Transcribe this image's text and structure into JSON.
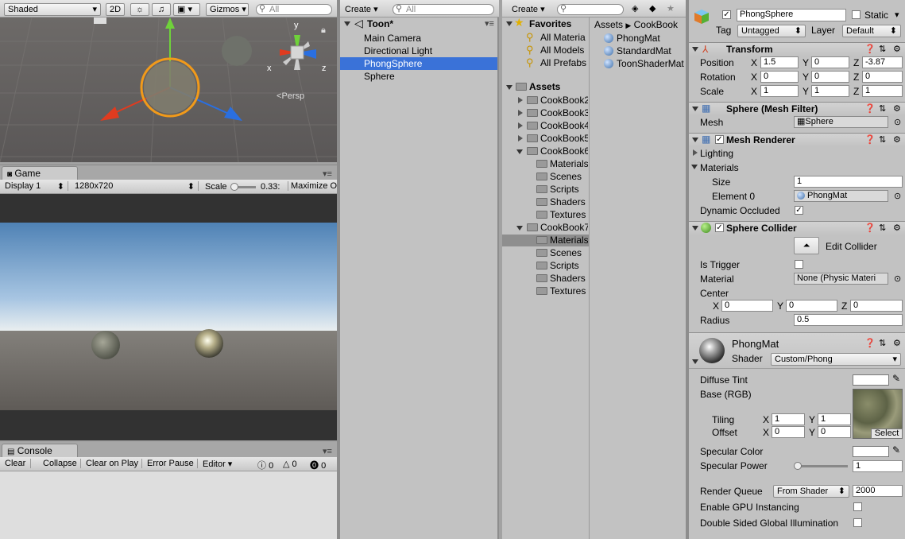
{
  "scene": {
    "shading_mode": "Shaded",
    "mode_2d": "2D",
    "gizmos_label": "Gizmos",
    "search_placeholder": "All",
    "persp_label": "Persp",
    "axes": {
      "y": "y",
      "x": "x",
      "z": "z"
    }
  },
  "game": {
    "tab_label": "Game",
    "display": "Display 1",
    "resolution": "1280x720",
    "scale_label": "Scale",
    "scale_value": "0.33:",
    "maximize_label": "Maximize O"
  },
  "console": {
    "tab_label": "Console",
    "buttons": [
      "Clear",
      "Collapse",
      "Clear on Play",
      "Error Pause",
      "Editor"
    ],
    "counts": {
      "info": "0",
      "warn": "0",
      "error": "0"
    }
  },
  "hierarchy": {
    "create_label": "Create",
    "search_placeholder": "All",
    "scene_name": "Toon*",
    "items": [
      "Main Camera",
      "Directional Light",
      "PhongSphere",
      "Sphere"
    ],
    "selected_index": 2
  },
  "project": {
    "create_label": "Create",
    "favorites_label": "Favorites",
    "favorites": [
      "All Materia",
      "All Models",
      "All Prefabs"
    ],
    "assets_label": "Assets",
    "folders": [
      {
        "name": "CookBook2",
        "level": 1,
        "expanded": false
      },
      {
        "name": "CookBook3",
        "level": 1,
        "expanded": false
      },
      {
        "name": "CookBook4",
        "level": 1,
        "expanded": false
      },
      {
        "name": "CookBook5",
        "level": 1,
        "expanded": false
      },
      {
        "name": "CookBook6",
        "level": 1,
        "expanded": true
      },
      {
        "name": "Materials",
        "level": 2
      },
      {
        "name": "Scenes",
        "level": 2
      },
      {
        "name": "Scripts",
        "level": 2
      },
      {
        "name": "Shaders",
        "level": 2
      },
      {
        "name": "Textures",
        "level": 2
      },
      {
        "name": "CookBook7",
        "level": 1,
        "expanded": true
      },
      {
        "name": "Materials",
        "level": 2,
        "selected": true
      },
      {
        "name": "Scenes",
        "level": 2
      },
      {
        "name": "Scripts",
        "level": 2
      },
      {
        "name": "Shaders",
        "level": 2
      },
      {
        "name": "Textures",
        "level": 2
      }
    ],
    "breadcrumb": [
      "Assets",
      "CookBook"
    ],
    "assets": [
      "PhongMat",
      "StandardMat",
      "ToonShaderMat"
    ]
  },
  "inspector": {
    "object_name": "PhongSphere",
    "static_label": "Static",
    "tag_label": "Tag",
    "tag_value": "Untagged",
    "layer_label": "Layer",
    "layer_value": "Default",
    "transform": {
      "title": "Transform",
      "rows": [
        {
          "label": "Position",
          "x": "1.5",
          "y": "0",
          "z": "-3.87"
        },
        {
          "label": "Rotation",
          "x": "0",
          "y": "0",
          "z": "0"
        },
        {
          "label": "Scale",
          "x": "1",
          "y": "1",
          "z": "1"
        }
      ]
    },
    "mesh_filter": {
      "title": "Sphere (Mesh Filter)",
      "mesh_label": "Mesh",
      "mesh_value": "Sphere"
    },
    "mesh_renderer": {
      "title": "Mesh Renderer",
      "lighting_label": "Lighting",
      "materials_label": "Materials",
      "size_label": "Size",
      "size_value": "1",
      "element0_label": "Element 0",
      "element0_value": "PhongMat",
      "dynamic_occluded_label": "Dynamic Occluded"
    },
    "sphere_collider": {
      "title": "Sphere Collider",
      "edit_label": "Edit Collider",
      "is_trigger_label": "Is Trigger",
      "material_label": "Material",
      "material_value": "None (Physic Materi",
      "center_label": "Center",
      "center": {
        "x": "0",
        "y": "0",
        "z": "0"
      },
      "radius_label": "Radius",
      "radius_value": "0.5"
    },
    "material": {
      "name": "PhongMat",
      "shader_label": "Shader",
      "shader_value": "Custom/Phong",
      "diffuse_tint_label": "Diffuse Tint",
      "base_label": "Base (RGB)",
      "tiling_label": "Tiling",
      "tiling": {
        "x": "1",
        "y": "1"
      },
      "offset_label": "Offset",
      "offset": {
        "x": "0",
        "y": "0"
      },
      "select_label": "Select",
      "specular_color_label": "Specular Color",
      "specular_power_label": "Specular Power",
      "specular_power_value": "1",
      "render_queue_label": "Render Queue",
      "render_queue_mode": "From Shader",
      "render_queue_value": "2000",
      "gpu_instancing_label": "Enable GPU Instancing",
      "double_sided_label": "Double Sided Global Illumination"
    }
  },
  "colors": {
    "selection": "#3a72d8",
    "panel_bg": "#c2c2c2",
    "toolbar": "#d6d6d6"
  }
}
